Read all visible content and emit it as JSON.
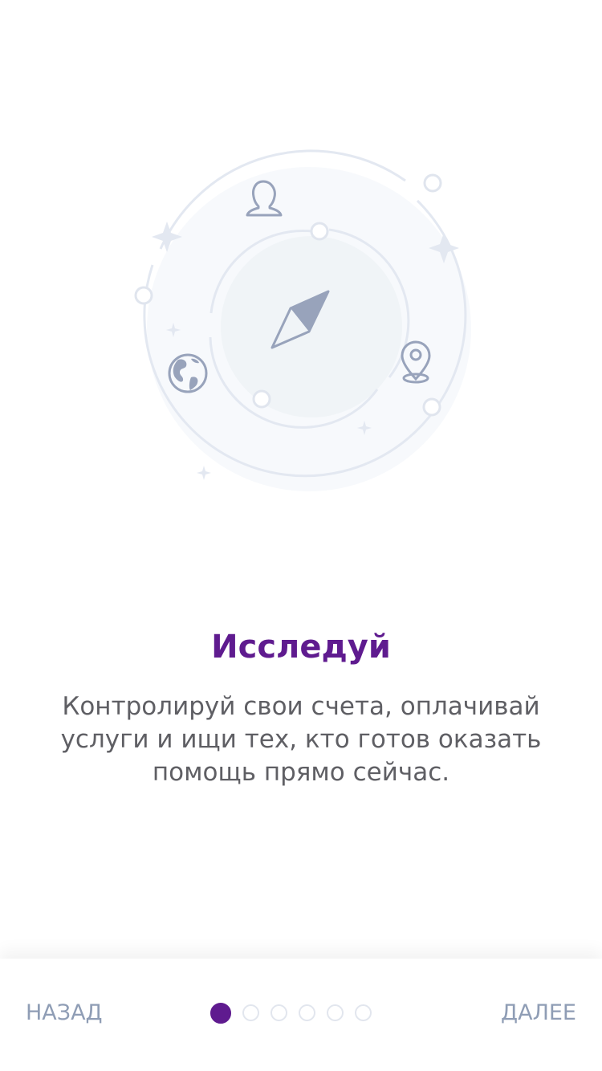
{
  "onboarding": {
    "title": "Исследуй",
    "description": "Контролируй свои счета, оплачивай услуги и ищи тех, кто готов оказать помощь прямо сейчас.",
    "illustration": {
      "icons": [
        "compass-icon",
        "user-icon",
        "globe-icon",
        "map-pin-icon",
        "sparkle-icon"
      ]
    }
  },
  "footer": {
    "back_label": "НАЗАД",
    "next_label": "ДАЛЕЕ",
    "pagination": {
      "total": 6,
      "active_index": 0
    }
  },
  "colors": {
    "accent": "#5f1b8f",
    "nav_text": "#8f9db5",
    "body_text": "#5f5f64",
    "illustration_line": "#e3e8f1",
    "icon_stroke": "#98a3bb"
  }
}
